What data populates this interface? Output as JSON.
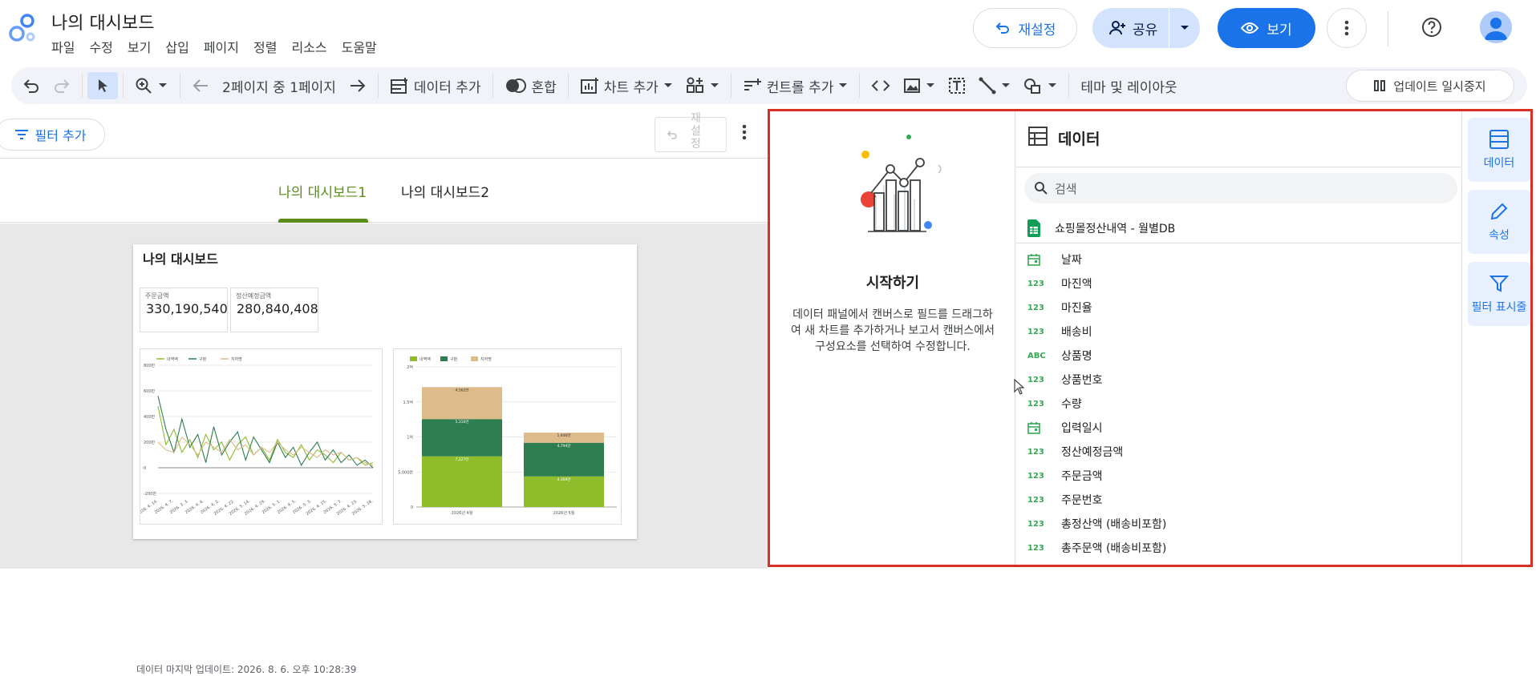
{
  "app": {
    "title": "나의 대시보드",
    "menu": [
      "파일",
      "수정",
      "보기",
      "삽입",
      "페이지",
      "정렬",
      "리소스",
      "도움말"
    ]
  },
  "header": {
    "reset_label": "재설정",
    "share_label": "공유",
    "view_label": "보기"
  },
  "toolbar": {
    "page_indicator": "2페이지 중 1페이지",
    "add_data": "데이터 추가",
    "blend": "혼합",
    "add_chart": "차트 추가",
    "add_control": "컨트롤 추가",
    "theme_layout": "테마 및 레이아웃",
    "pause_updates": "업데이트 일시중지"
  },
  "filter_bar": {
    "add_filter": "필터 추가",
    "reset_vertical": [
      "재",
      "설",
      "정"
    ]
  },
  "page_tabs": [
    "나의 대시보드1",
    "나의 대시보드2"
  ],
  "report": {
    "title": "나의 대시보드",
    "scorecards": [
      {
        "label": "주문금액",
        "value": "330,190,540"
      },
      {
        "label": "정산예정금액",
        "value": "280,840,408"
      }
    ],
    "line_chart": {
      "legend": [
        "내역액",
        "구분",
        "지하명"
      ]
    },
    "bar_chart": {
      "legend": [
        "내역액",
        "구분",
        "지하명"
      ]
    },
    "last_update": "데이터 마지막 업데이트: 2026. 8. 6. 오후 10:28:39"
  },
  "chart_data": [
    {
      "type": "line",
      "series": [
        {
          "name": "내역액",
          "values": [
            480,
            180,
            300,
            120,
            220,
            80,
            260,
            140,
            200,
            60,
            180,
            240,
            100,
            160,
            60,
            220,
            120,
            80,
            180,
            60,
            140,
            100,
            40,
            120,
            60,
            80,
            20,
            40
          ]
        },
        {
          "name": "구분",
          "values": [
            560,
            300,
            120,
            380,
            160,
            260,
            40,
            320,
            100,
            200,
            280,
            60,
            240,
            140,
            40,
            200,
            80,
            160,
            20,
            120,
            200,
            60,
            140,
            40,
            100,
            20,
            60,
            0
          ]
        },
        {
          "name": "지하명",
          "values": [
            200,
            140,
            120,
            240,
            180,
            100,
            200,
            160,
            120,
            220,
            140,
            180,
            100,
            160,
            120,
            200,
            140,
            100,
            160,
            120,
            80,
            140,
            100,
            120,
            60,
            80,
            40,
            20
          ]
        }
      ],
      "y_ticks": [
        "800만",
        "600만",
        "400만",
        "200만",
        "0",
        "-200만"
      ],
      "ylim": [
        -200,
        800
      ],
      "x": [
        "2026. 4. 14.",
        "2026. 4. 7.",
        "2026. 3. 3.",
        "2026. 4. 6.",
        "2026. 4. 2.",
        "2026. 4. 22.",
        "2026. 5. 14.",
        "2026. 4. 29.",
        "2026. 5. 1.",
        "2026. 4. 5.",
        "2026. 5. 3.",
        "2026. 4. 15.",
        "2026. 5. 7.",
        "2026. 4. 23.",
        "2026. 5. 28."
      ]
    },
    {
      "type": "bar",
      "stacked": true,
      "categories": [
        "2026년 4월",
        "2026년 5월"
      ],
      "series": [
        {
          "name": "내역액",
          "values": [
            7.227,
            4.368
          ],
          "labels": [
            "7,227만",
            "4,368만"
          ]
        },
        {
          "name": "구분",
          "values": [
            5.316,
            4.794
          ],
          "labels": [
            "5,316만",
            "4,794만"
          ]
        },
        {
          "name": "지하명",
          "values": [
            4.562,
            1.446
          ],
          "labels": [
            "4,562만",
            "1,446만"
          ]
        }
      ],
      "y_ticks": [
        "2억",
        "1.5억",
        "1억",
        "5,000만",
        "0"
      ],
      "ylim": [
        0,
        20
      ]
    }
  ],
  "getting_started": {
    "title": "시작하기",
    "description": "데이터 패널에서 캔버스로 필드를 드래그하여 새 차트를 추가하거나 보고서 캔버스에서 구성요소를 선택하여 수정합니다."
  },
  "data_panel": {
    "title": "데이터",
    "search_placeholder": "검색",
    "source_name": "쇼핑몰정산내역 - 월별DB",
    "fields": [
      {
        "type": "date",
        "name": "날짜"
      },
      {
        "type": "number",
        "name": "마진액"
      },
      {
        "type": "number",
        "name": "마진율"
      },
      {
        "type": "number",
        "name": "배송비"
      },
      {
        "type": "text",
        "name": "상품명"
      },
      {
        "type": "number",
        "name": "상품번호"
      },
      {
        "type": "number",
        "name": "수량"
      },
      {
        "type": "date",
        "name": "입력일시"
      },
      {
        "type": "number",
        "name": "정산예정금액"
      },
      {
        "type": "number",
        "name": "주문금액"
      },
      {
        "type": "number",
        "name": "주문번호"
      },
      {
        "type": "number",
        "name": "총정산액 (배송비포함)"
      },
      {
        "type": "number",
        "name": "총주문액 (배송비포함)"
      }
    ],
    "type_codes": {
      "number": "123",
      "text": "ABC"
    }
  },
  "rail": {
    "data": "데이터",
    "properties": "속성",
    "filter": "필터 표시줄"
  },
  "colors": {
    "accent": "#1a73e8",
    "active_tab": "#5b8c1a",
    "highlight_border": "#d93025",
    "series1": "#8dbd2a",
    "series2": "#2e7d4f",
    "series3": "#ddbb8a"
  }
}
